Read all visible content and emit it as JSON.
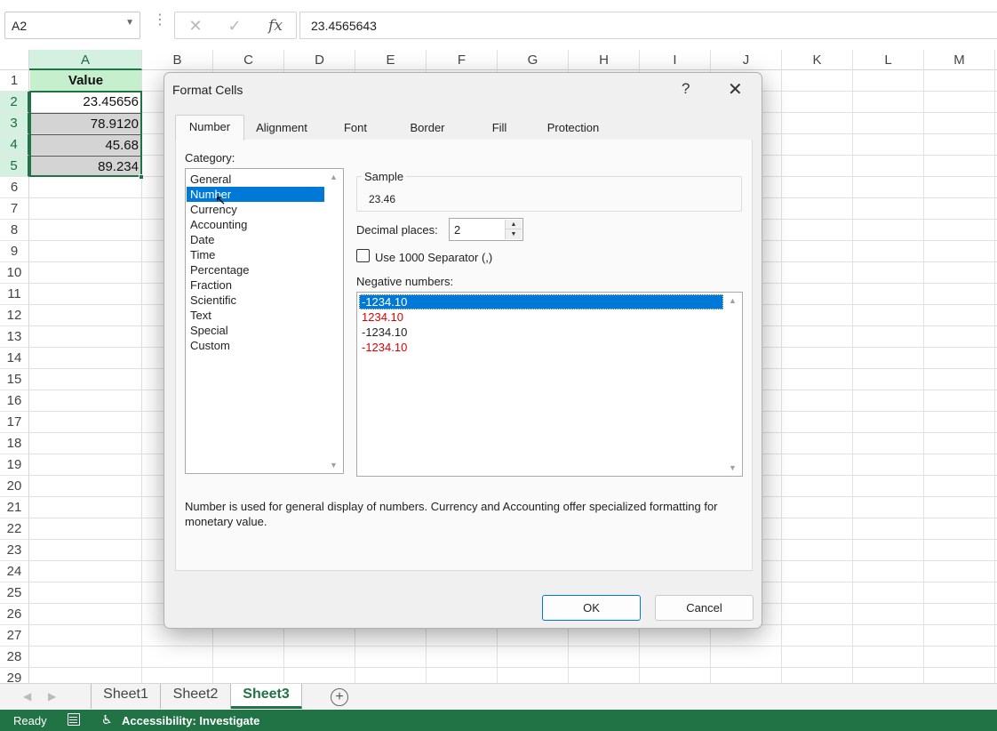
{
  "formula_bar": {
    "name_box": "A2",
    "cancel_icon": "✕",
    "enter_icon": "✓",
    "function_icon": "fx",
    "formula": "23.4565643"
  },
  "grid": {
    "columns": [
      "A",
      "B",
      "C",
      "D",
      "E",
      "F",
      "G",
      "H",
      "I",
      "J",
      "K",
      "L",
      "M"
    ],
    "rows": [
      "1",
      "2",
      "3",
      "4",
      "5",
      "6",
      "7",
      "8",
      "9",
      "10",
      "11",
      "12",
      "13",
      "14",
      "15",
      "16",
      "17",
      "18",
      "19",
      "20",
      "21",
      "22",
      "23",
      "24",
      "25",
      "26",
      "27",
      "28",
      "29"
    ],
    "cells": {
      "A1": "Value",
      "A2": "23.45656",
      "A3": "78.9120",
      "A4": "45.68",
      "A5": "89.234"
    },
    "header_fill": "#c6efce",
    "selection_color": "#217346"
  },
  "sheet_tabs": [
    {
      "label": "Sheet1"
    },
    {
      "label": "Sheet2"
    },
    {
      "label": "Sheet3"
    }
  ],
  "status_bar": {
    "ready": "Ready",
    "accessibility": "Accessibility: Investigate",
    "bg_color": "#217346"
  },
  "dialog": {
    "title": "Format Cells",
    "help": "?",
    "close": "✕",
    "tabs": [
      "Number",
      "Alignment",
      "Font",
      "Border",
      "Fill",
      "Protection"
    ],
    "active_tab": "Number",
    "category_label": "Category:",
    "categories": [
      "General",
      "Number",
      "Currency",
      "Accounting",
      "Date",
      "Time",
      "Percentage",
      "Fraction",
      "Scientific",
      "Text",
      "Special",
      "Custom"
    ],
    "selected_category": "Number",
    "sample_label": "Sample",
    "sample_value": "23.46",
    "decimal_places_label": "Decimal places:",
    "decimal_places": "2",
    "separator_label": "Use 1000 Separator (,)",
    "separator_checked": false,
    "negative_label": "Negative numbers:",
    "negative_numbers": [
      {
        "text": "-1234.10",
        "color": "#222222",
        "selected": true
      },
      {
        "text": "1234.10",
        "color": "#e00000",
        "selected": false
      },
      {
        "text": "-1234.10",
        "color": "#222222",
        "selected": false
      },
      {
        "text": "-1234.10",
        "color": "#e00000",
        "selected": false
      }
    ],
    "description": "Number is used for general display of numbers.  Currency and Accounting offer specialized formatting for monetary value.",
    "ok_label": "OK",
    "cancel_label": "Cancel",
    "accent_color": "#0078d7"
  }
}
